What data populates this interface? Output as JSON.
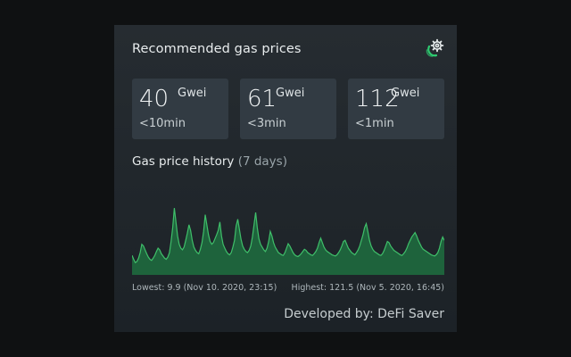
{
  "header": {
    "title": "Recommended gas prices",
    "settings_icon": "settings-gear-moon-icon"
  },
  "prices": [
    {
      "value": "40",
      "unit": "Gwei",
      "time": "<10min"
    },
    {
      "value": "61",
      "unit": "Gwei",
      "time": "<3min"
    },
    {
      "value": "112",
      "unit": "Gwei",
      "time": "<1min"
    }
  ],
  "history": {
    "title": "Gas price history",
    "period": "(7 days)",
    "lowest": "Lowest: 9.9 (Nov 10. 2020, 23:15)",
    "highest": "Highest: 121.5 (Nov 5. 2020, 16:45)"
  },
  "footer": {
    "credit": "Developed by: DeFi Saver"
  },
  "colors": {
    "accent": "#2ecc71",
    "chart_line": "#3fbf6a",
    "chart_fill": "#1f6e3f",
    "panel_bg": "#242a2f",
    "card_bg": "#323b43"
  },
  "chart_data": {
    "type": "area",
    "series": [
      {
        "values": [
          35,
          28,
          22,
          24,
          30,
          40,
          55,
          52,
          45,
          38,
          32,
          28,
          26,
          30,
          35,
          42,
          48,
          45,
          38,
          34,
          30,
          28,
          32,
          40,
          60,
          85,
          120,
          95,
          70,
          55,
          48,
          45,
          50,
          62,
          75,
          90,
          80,
          62,
          50,
          44,
          40,
          38,
          46,
          58,
          78,
          108,
          90,
          72,
          60,
          55,
          58,
          65,
          72,
          80,
          95,
          70,
          55,
          48,
          42,
          38,
          36,
          40,
          50,
          62,
          88,
          100,
          82,
          64,
          52,
          46,
          42,
          40,
          44,
          52,
          68,
          90,
          112,
          85,
          65,
          55,
          50,
          45,
          42,
          48,
          60,
          78,
          70,
          58,
          50,
          45,
          40,
          38,
          36,
          35,
          40,
          48,
          56,
          52,
          46,
          40,
          36,
          34,
          33,
          35,
          38,
          42,
          46,
          44,
          40,
          38,
          36,
          35,
          38,
          42,
          48,
          58,
          66,
          58,
          50,
          45,
          42,
          40,
          38,
          36,
          35,
          34,
          36,
          40,
          45,
          52,
          60,
          62,
          55,
          48,
          44,
          40,
          38,
          36,
          40,
          45,
          52,
          62,
          72,
          85,
          92,
          78,
          62,
          52,
          46,
          42,
          40,
          38,
          36,
          35,
          38,
          44,
          52,
          60,
          58,
          52,
          48,
          44,
          42,
          40,
          38,
          36,
          35,
          38,
          42,
          48,
          56,
          62,
          68,
          72,
          76,
          70,
          62,
          56,
          50,
          46,
          44,
          42,
          40,
          38,
          36,
          35,
          34,
          36,
          40,
          48,
          60,
          68,
          62
        ]
      }
    ]
  }
}
